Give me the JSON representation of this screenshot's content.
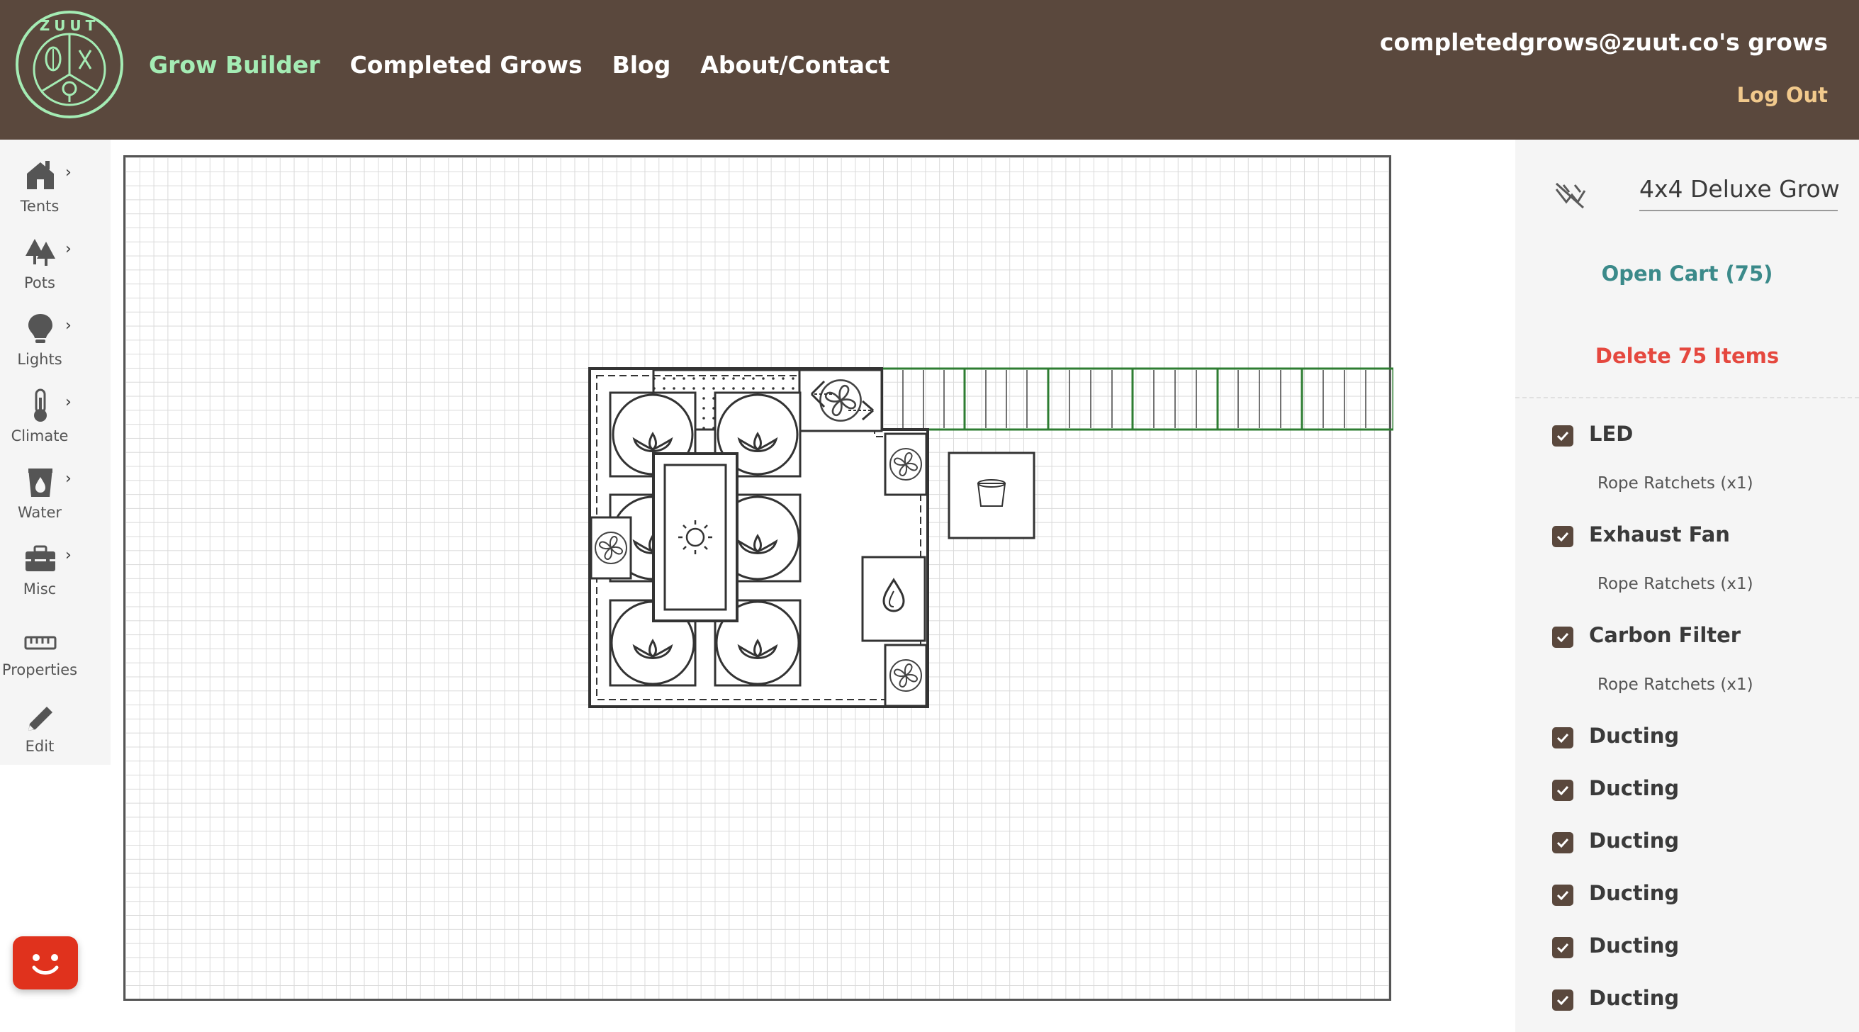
{
  "header": {
    "nav": [
      {
        "label": "Grow Builder",
        "active": true
      },
      {
        "label": "Completed Grows",
        "active": false
      },
      {
        "label": "Blog",
        "active": false
      },
      {
        "label": "About/Contact",
        "active": false
      }
    ],
    "user_email": "completedgrows@zuut.co's grows",
    "logout_label": "Log Out",
    "logo_text": "ZUUT",
    "colors": {
      "bg": "#5a483d",
      "active": "#a4ecb4",
      "logout": "#f1c98c"
    }
  },
  "toolbar": {
    "items": [
      {
        "label": "Tents",
        "icon": "tent-icon",
        "has_arrow": true
      },
      {
        "label": "Pots",
        "icon": "trees-icon",
        "has_arrow": true
      },
      {
        "label": "Lights",
        "icon": "lightbulb-icon",
        "has_arrow": true
      },
      {
        "label": "Climate",
        "icon": "thermometer-icon",
        "has_arrow": true
      },
      {
        "label": "Water",
        "icon": "water-bucket-icon",
        "has_arrow": true
      },
      {
        "label": "Misc",
        "icon": "toolbox-icon",
        "has_arrow": true
      },
      {
        "label": "Properties",
        "icon": "ruler-icon",
        "has_arrow": false
      },
      {
        "label": "Edit",
        "icon": "pencil-icon",
        "has_arrow": false
      }
    ]
  },
  "panel": {
    "grow_name": "4x4 Deluxe Grow",
    "open_cart_label": "Open Cart (75)",
    "delete_label": "Delete 75 Items",
    "items": [
      {
        "label": "LED",
        "checked": true,
        "sub": "Rope Ratchets (x1)"
      },
      {
        "label": "Exhaust Fan",
        "checked": true,
        "sub": "Rope Ratchets (x1)"
      },
      {
        "label": "Carbon Filter",
        "checked": true,
        "sub": "Rope Ratchets (x1)"
      },
      {
        "label": "Ducting",
        "checked": true,
        "sub": null
      },
      {
        "label": "Ducting",
        "checked": true,
        "sub": null
      },
      {
        "label": "Ducting",
        "checked": true,
        "sub": null
      },
      {
        "label": "Ducting",
        "checked": true,
        "sub": null
      },
      {
        "label": "Ducting",
        "checked": true,
        "sub": null
      },
      {
        "label": "Ducting",
        "checked": true,
        "sub": null
      }
    ],
    "colors": {
      "open_cart": "#3b8a8a",
      "delete": "#e5483f",
      "checkbox": "#5a483d"
    }
  },
  "chat_widget": {
    "icon": "chat-face-icon",
    "color": "#e0321d"
  }
}
